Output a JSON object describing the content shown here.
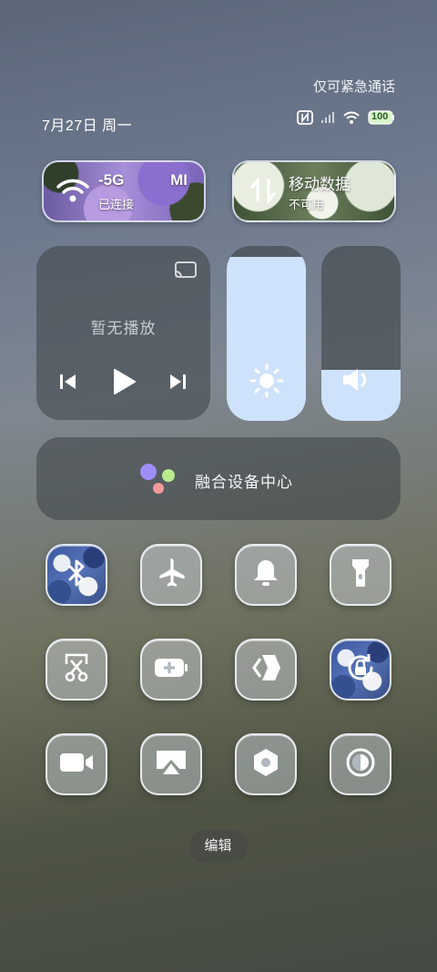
{
  "status": {
    "emergency_text": "仅可紧急通话",
    "date_text": "7月27日 周一",
    "battery_level": "100"
  },
  "quick_tiles": {
    "wifi": {
      "name": "-5G",
      "status": "已连接",
      "badge": "MI"
    },
    "mobile_data": {
      "name": "移动数据",
      "status": "不可用"
    }
  },
  "media": {
    "status_text": "暂无播放"
  },
  "sliders": {
    "brightness_level": 0.94,
    "volume_level": 0.29
  },
  "device_hub": {
    "label": "融合设备中心"
  },
  "toggles": [
    {
      "icon": "bluetooth-icon",
      "active": true
    },
    {
      "icon": "airplane-icon",
      "active": false
    },
    {
      "icon": "bell-icon",
      "active": false
    },
    {
      "icon": "flashlight-icon",
      "active": false
    },
    {
      "icon": "screenshot-icon",
      "active": false
    },
    {
      "icon": "battery-saver-icon",
      "active": false
    },
    {
      "icon": "ai-link-icon",
      "active": false
    },
    {
      "icon": "rotation-lock-icon",
      "active": true
    },
    {
      "icon": "video-camera-icon",
      "active": false
    },
    {
      "icon": "screen-cast-icon",
      "active": false
    },
    {
      "icon": "settings-hex-icon",
      "active": false
    },
    {
      "icon": "dark-mode-icon",
      "active": false
    }
  ],
  "footer": {
    "edit_label": "编辑"
  },
  "colors": {
    "accent_light_blue": "#cfe2fb",
    "tile_border": "#f0f4fa"
  }
}
